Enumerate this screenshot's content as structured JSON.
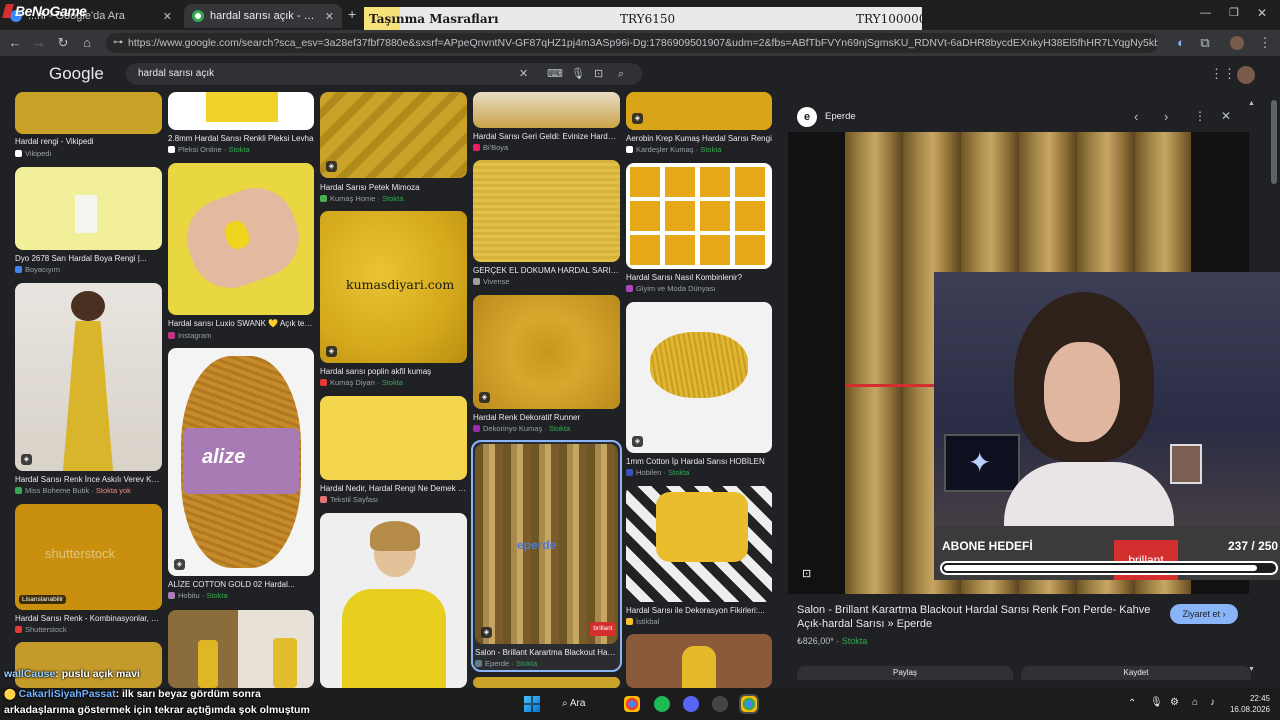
{
  "stream": {
    "logo": "BeNoGame"
  },
  "browser": {
    "tabs": [
      {
        "title": "...ni - Google'da Ara"
      },
      {
        "title": "hardal sarısı açık - Google'da Ara"
      }
    ],
    "url": "https://www.google.com/search?sca_esv=3a28ef37fbf7880e&sxsrf=APpeQnvntNV-GF87qHZ1pj4m3ASp96i-Dg:1786909501907&udm=2&fbs=ABfTbFVYn69njSgmsKU_RDNVt-6aDHR8bycdEXnkyH38El5fhHR7LYqgNy5kb5WtNH1Nq9nfs19..."
  },
  "expense_banner": {
    "title": "Taşınma Masrafları",
    "value1": "TRY6150",
    "value2": "TRY100000"
  },
  "google": {
    "logo": "Google",
    "query": "hardal sarısı açık"
  },
  "results": [
    {
      "caption": "Hardal rengi - Vikipedi",
      "source": "Vikipedi",
      "stock": ""
    },
    {
      "caption": "Dyo 2678 Sarı Hardal Boya Rengi |...",
      "source": "Boyacıyım",
      "stock": ""
    },
    {
      "caption": "Hardal Sarısı Renk İnce Askılı Verev Kesi...",
      "source": "Miss Boheme Butik",
      "stock": "Stokta yok"
    },
    {
      "caption": "Hardal Sarısı Renk - Kombinasyonlar, HE...",
      "source": "Shutterstock",
      "stock": ""
    },
    {
      "caption": "2.8mm Hardal Sarısı Renkli Pleksi Levha",
      "source": "Pleksi Online",
      "stock": "Stokta"
    },
    {
      "caption": "Hardal sarısı Luxio SWANK 💛 Açık tenli...",
      "source": "Instagram",
      "stock": ""
    },
    {
      "caption": "ALİZE COTTON GOLD 02 Hardal...",
      "source": "Hobitu",
      "stock": "Stokta"
    },
    {
      "caption": "Hardal Sarısı Petek Mimoza",
      "source": "Kumaş Home",
      "stock": "Stokta"
    },
    {
      "caption": "Hardal sarısı poplin akfil kumaş",
      "source": "Kumaş Diyarı",
      "stock": "Stokta"
    },
    {
      "caption": "Hardal Nedir, Hardal Rengi Ne Demek - ...",
      "source": "Tekstil Sayfası",
      "stock": ""
    },
    {
      "caption": "Hardal Sarısı Geri Geldi: Evinize Hardalla...",
      "source": "Bi'Boya",
      "stock": ""
    },
    {
      "caption": "GERÇEK EL DOKUMA HARDAL SARISI...",
      "source": "Vivense",
      "stock": ""
    },
    {
      "caption": "Hardal Renk Dekoratif Runner",
      "source": "Dekorinyo Kumaş",
      "stock": "Stokta"
    },
    {
      "caption": "Salon - Brillant Karartma Blackout Hard...",
      "source": "Eperde",
      "stock": "Stokta"
    },
    {
      "caption": "Aerobin Krep Kumaş Hardal Sarısı Rengi",
      "source": "Kardeşler Kumaş",
      "stock": "Stokta"
    },
    {
      "caption": "Hardal Sarısı Nasıl Kombinlenir?",
      "source": "Giyim ve Moda Dünyası",
      "stock": ""
    },
    {
      "caption": "1mm Cotton İp Hardal Sarısı HOBİLEN",
      "source": "Hobilen",
      "stock": "Stokta"
    },
    {
      "caption": "Hardal Sarısı ile Dekorasyon Fikirleri:...",
      "source": "İstikbal",
      "stock": ""
    }
  ],
  "image_texts": {
    "kumasdiyari": "kumasdiyari.com",
    "shutterstock": "shutterstock",
    "lisans": "Lisanslanabilir",
    "alize": "alize",
    "brillant": "brillant",
    "eperde": "eperde"
  },
  "panel": {
    "site": "Eperde",
    "title": "Salon - Brillant Karartma Blackout Hardal Sarısı Renk Fon Perde- Kahve Açık-hardal Sarısı » Eperde",
    "price": "₺826,00*",
    "stock": "Stokta",
    "visit": "Ziyaret et",
    "share": "Paylaş",
    "save": "Kaydet"
  },
  "goal": {
    "label": "ABONE HEDEFİ",
    "current": "237",
    "sep": "/",
    "target": "250",
    "progress": 0.948
  },
  "chat": [
    {
      "user": "wallCause",
      "message": ": puslu açık mavi"
    },
    {
      "user": "CakarliSiyahPassat",
      "message": ": ilk sarı beyaz gördüm sonra"
    },
    {
      "user": "",
      "message": "arkadaşlarıma göstermek için tekrar açtığımda şok olmuştum"
    }
  ],
  "taskbar": {
    "search": "Ara",
    "time": "22:45",
    "date": "16.08.2026"
  },
  "colors": {
    "mustard": "#c9a227",
    "google_bg": "#202124",
    "stock_green": "#34a853",
    "visit_btn": "#8ab4f8"
  }
}
